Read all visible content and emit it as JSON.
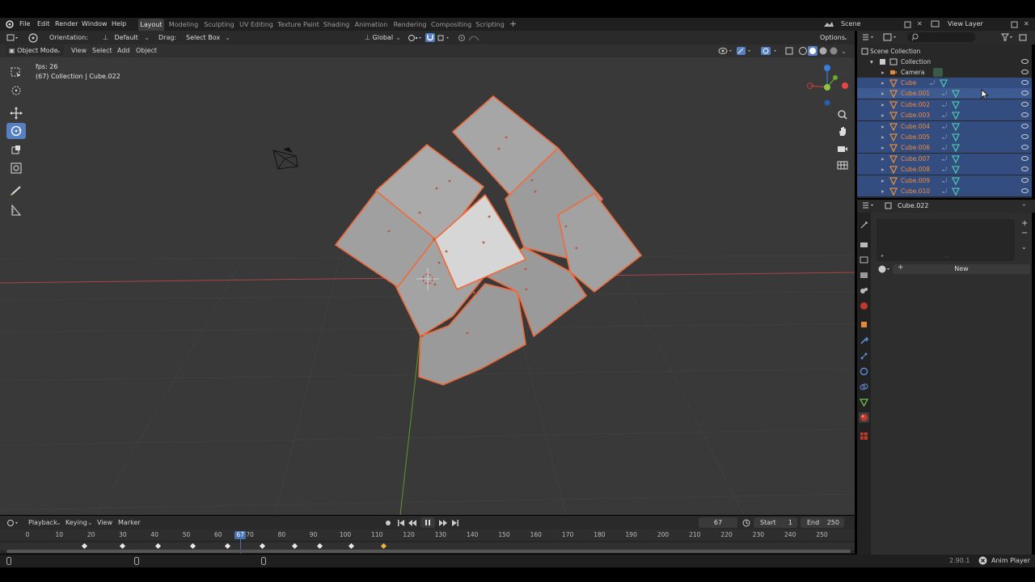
{
  "menubar": {
    "menus": [
      "File",
      "Edit",
      "Render",
      "Window",
      "Help"
    ],
    "workspaces": [
      "Layout",
      "Modeling",
      "Sculpting",
      "UV Editing",
      "Texture Paint",
      "Shading",
      "Animation",
      "Rendering",
      "Compositing",
      "Scripting"
    ],
    "active_workspace": "Layout",
    "scene_label": "Scene",
    "view_layer_label": "View Layer"
  },
  "header": {
    "orientation_label": "Orientation:",
    "orientation_value": "Default",
    "drag_label": "Drag:",
    "drag_value": "Select Box",
    "transform_orientation": "Global",
    "options_label": "Options"
  },
  "viewport_header": {
    "mode": "Object Mode",
    "menus": [
      "View",
      "Select",
      "Add",
      "Object"
    ]
  },
  "overlay": {
    "fps": "fps: 26",
    "collection_info": "(67) Collection | Cube.022"
  },
  "outliner": {
    "scene_collection": "Scene Collection",
    "collection": "Collection",
    "camera": "Camera",
    "objects": [
      "Cube",
      "Cube.001",
      "Cube.002",
      "Cube.003",
      "Cube.004",
      "Cube.005",
      "Cube.006",
      "Cube.007",
      "Cube.008",
      "Cube.009",
      "Cube.010"
    ]
  },
  "properties": {
    "object_name": "Cube.022",
    "new_button": "New"
  },
  "timeline": {
    "menus": [
      "Playback",
      "Keying",
      "View",
      "Marker"
    ],
    "current_frame": "67",
    "start_label": "Start",
    "start_value": "1",
    "end_label": "End",
    "end_value": "250",
    "ruler": [
      "0",
      "10",
      "20",
      "30",
      "40",
      "50",
      "60",
      "70",
      "80",
      "90",
      "100",
      "110",
      "120",
      "130",
      "140",
      "150",
      "160",
      "170",
      "180",
      "190",
      "200",
      "210",
      "220",
      "230",
      "240",
      "250"
    ],
    "playhead_label": "67"
  },
  "status": {
    "version": "2.90.1",
    "app_label": "Anim Player"
  },
  "colors": {
    "accent": "#5680c2",
    "selection_outline": "#f06a3a",
    "x_axis": "#c74a4a",
    "y_axis": "#6aa82e"
  }
}
